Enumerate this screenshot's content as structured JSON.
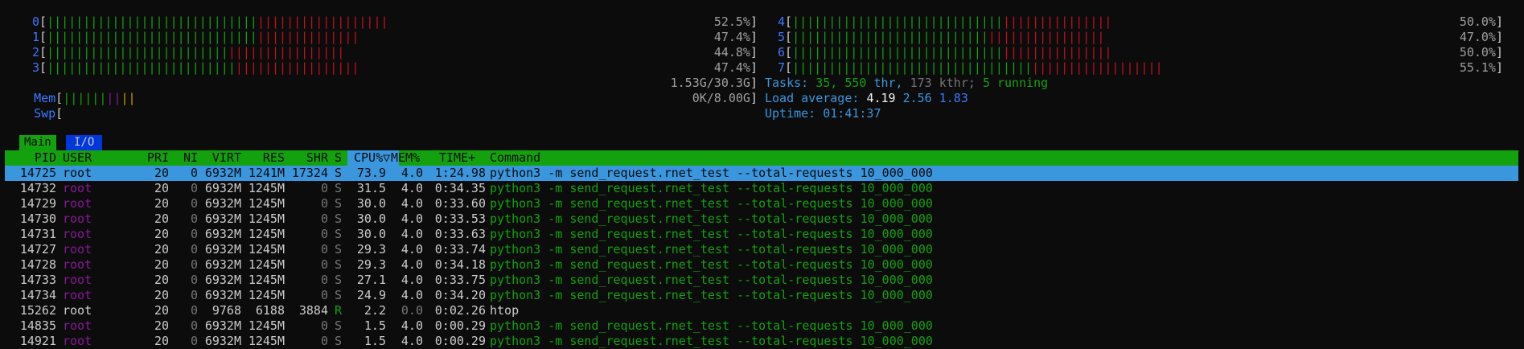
{
  "cpus_left": [
    {
      "label": "0",
      "green": 29,
      "red": 18,
      "pct": "52.5%"
    },
    {
      "label": "1",
      "green": 29,
      "red": 14,
      "pct": "47.4%"
    },
    {
      "label": "2",
      "green": 25,
      "red": 16,
      "pct": "44.8%"
    },
    {
      "label": "3",
      "green": 26,
      "red": 17,
      "pct": "47.4%"
    }
  ],
  "cpus_right": [
    {
      "label": "4",
      "green": 29,
      "red": 15,
      "pct": "50.0%"
    },
    {
      "label": "5",
      "green": 27,
      "red": 16,
      "pct": "47.0%"
    },
    {
      "label": "6",
      "green": 29,
      "red": 15,
      "pct": "50.0%"
    },
    {
      "label": "7",
      "green": 33,
      "red": 18,
      "pct": "55.1%"
    }
  ],
  "mem": {
    "label": "Mem",
    "value": "1.53G/30.3G"
  },
  "swp": {
    "label": "Swp",
    "value": "0K/8.00G"
  },
  "tasks": {
    "label": "Tasks:",
    "count": "35,",
    "thr": "550",
    "thr_label": "thr,",
    "kthr": "173",
    "kthr_label": "kthr;",
    "running": "5",
    "running_label": "running"
  },
  "load": {
    "label": "Load average:",
    "l1": "4.19",
    "l5": "2.56",
    "l15": "1.83"
  },
  "uptime": {
    "label": "Uptime:",
    "value": "01:41:37"
  },
  "tabs": [
    "Main",
    "I/O"
  ],
  "columns": [
    "PID",
    "USER",
    "PRI",
    "NI",
    "VIRT",
    "RES",
    "SHR",
    "S",
    "CPU%▽",
    "MEM%",
    "TIME+",
    "Command"
  ],
  "processes": [
    {
      "pid": "14725",
      "user": "root",
      "pri": "20",
      "ni": "0",
      "virt": "6932M",
      "res": "1241M",
      "shr": "17324",
      "s": "S",
      "cpu": "73.9",
      "mem": "4.0",
      "time": "1:24.98",
      "cmd": "python3 -m send_request.rnet_test --total-requests 10_000_000"
    },
    {
      "pid": "14732",
      "user": "root",
      "pri": "20",
      "ni": "0",
      "virt": "6932M",
      "res": "1245M",
      "shr": "0",
      "s": "S",
      "cpu": "31.5",
      "mem": "4.0",
      "time": "0:34.35",
      "cmd": "python3 -m send_request.rnet_test --total-requests 10_000_000"
    },
    {
      "pid": "14729",
      "user": "root",
      "pri": "20",
      "ni": "0",
      "virt": "6932M",
      "res": "1245M",
      "shr": "0",
      "s": "S",
      "cpu": "30.0",
      "mem": "4.0",
      "time": "0:33.60",
      "cmd": "python3 -m send_request.rnet_test --total-requests 10_000_000"
    },
    {
      "pid": "14730",
      "user": "root",
      "pri": "20",
      "ni": "0",
      "virt": "6932M",
      "res": "1245M",
      "shr": "0",
      "s": "S",
      "cpu": "30.0",
      "mem": "4.0",
      "time": "0:33.53",
      "cmd": "python3 -m send_request.rnet_test --total-requests 10_000_000"
    },
    {
      "pid": "14731",
      "user": "root",
      "pri": "20",
      "ni": "0",
      "virt": "6932M",
      "res": "1245M",
      "shr": "0",
      "s": "S",
      "cpu": "30.0",
      "mem": "4.0",
      "time": "0:33.63",
      "cmd": "python3 -m send_request.rnet_test --total-requests 10_000_000"
    },
    {
      "pid": "14727",
      "user": "root",
      "pri": "20",
      "ni": "0",
      "virt": "6932M",
      "res": "1245M",
      "shr": "0",
      "s": "S",
      "cpu": "29.3",
      "mem": "4.0",
      "time": "0:33.74",
      "cmd": "python3 -m send_request.rnet_test --total-requests 10_000_000"
    },
    {
      "pid": "14728",
      "user": "root",
      "pri": "20",
      "ni": "0",
      "virt": "6932M",
      "res": "1245M",
      "shr": "0",
      "s": "S",
      "cpu": "29.3",
      "mem": "4.0",
      "time": "0:34.18",
      "cmd": "python3 -m send_request.rnet_test --total-requests 10_000_000"
    },
    {
      "pid": "14733",
      "user": "root",
      "pri": "20",
      "ni": "0",
      "virt": "6932M",
      "res": "1245M",
      "shr": "0",
      "s": "S",
      "cpu": "27.1",
      "mem": "4.0",
      "time": "0:33.75",
      "cmd": "python3 -m send_request.rnet_test --total-requests 10_000_000"
    },
    {
      "pid": "14734",
      "user": "root",
      "pri": "20",
      "ni": "0",
      "virt": "6932M",
      "res": "1245M",
      "shr": "0",
      "s": "S",
      "cpu": "24.9",
      "mem": "4.0",
      "time": "0:34.20",
      "cmd": "python3 -m send_request.rnet_test --total-requests 10_000_000"
    },
    {
      "pid": "15262",
      "user": "root",
      "pri": "20",
      "ni": "0",
      "virt": "9768",
      "res": "6188",
      "shr": "3884",
      "s": "R",
      "cpu": "2.2",
      "mem": "0.0",
      "time": "0:02.26",
      "cmd": "htop"
    },
    {
      "pid": "14835",
      "user": "root",
      "pri": "20",
      "ni": "0",
      "virt": "6932M",
      "res": "1245M",
      "shr": "0",
      "s": "S",
      "cpu": "1.5",
      "mem": "4.0",
      "time": "0:00.29",
      "cmd": "python3 -m send_request.rnet_test --total-requests 10_000_000"
    },
    {
      "pid": "14921",
      "user": "root",
      "pri": "20",
      "ni": "0",
      "virt": "6932M",
      "res": "1245M",
      "shr": "0",
      "s": "S",
      "cpu": "1.5",
      "mem": "4.0",
      "time": "0:00.29",
      "cmd": "python3 -m send_request.rnet_test --total-requests 10_000_000"
    }
  ],
  "colors": {
    "bg": "#0c0c0c",
    "green": "#13a10e",
    "red": "#c50f1f",
    "blue": "#3b78ff",
    "cyan": "#3a96dd",
    "magenta": "#881798",
    "yellow": "#c19c00"
  }
}
